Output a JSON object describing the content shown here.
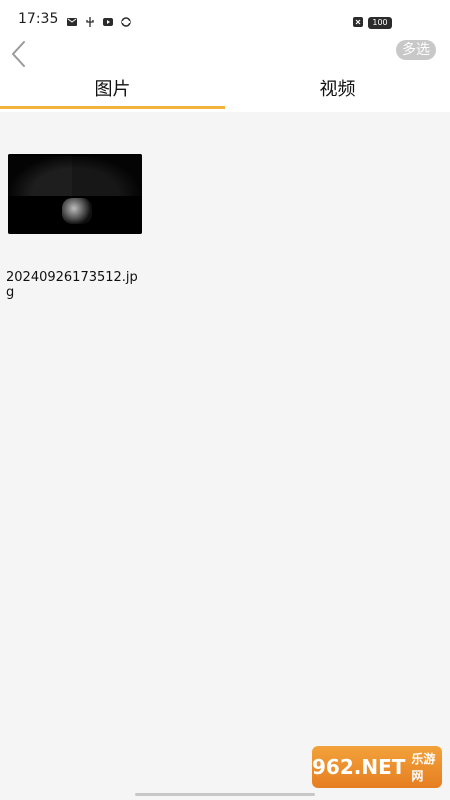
{
  "status_bar": {
    "time": "17:35",
    "battery": "100"
  },
  "header": {
    "multi_select_label": "多选",
    "back_icon": "chevron-left-icon"
  },
  "tabs": [
    {
      "label": "图片",
      "active": true
    },
    {
      "label": "视频",
      "active": false
    }
  ],
  "files": [
    {
      "name": "20240926173512.jpg"
    }
  ],
  "watermark": {
    "main": "962.NET",
    "sub": "乐游网"
  },
  "colors": {
    "accent": "#f3b23c",
    "background": "#f5f5f5",
    "button_bg": "#c8c8c8"
  }
}
